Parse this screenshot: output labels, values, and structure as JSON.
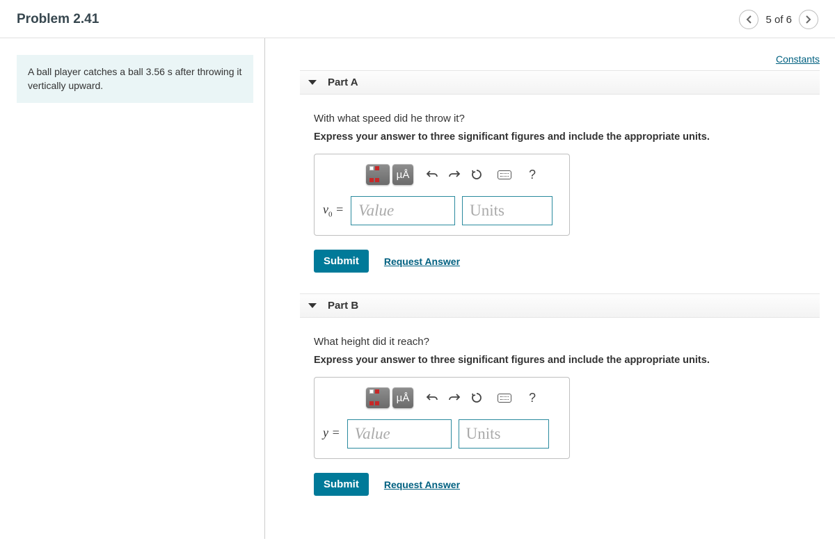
{
  "header": {
    "title": "Problem 2.41",
    "nav_count": "5 of 6"
  },
  "constants_link": "Constants",
  "prompt": "A ball player catches a ball 3.56 s after throwing it vertically upward.",
  "parts": {
    "a": {
      "title": "Part A",
      "question": "With what speed did he throw it?",
      "instruction": "Express your answer to three significant figures and include the appropriate units.",
      "variable_html": "v",
      "variable_sub": "0",
      "value_ph": "Value",
      "units_ph": "Units",
      "submit": "Submit",
      "request": "Request Answer"
    },
    "b": {
      "title": "Part B",
      "question": "What height did it reach?",
      "instruction": "Express your answer to three significant figures and include the appropriate units.",
      "variable_html": "y",
      "variable_sub": "",
      "value_ph": "Value",
      "units_ph": "Units",
      "submit": "Submit",
      "request": "Request Answer"
    }
  },
  "toolbar": {
    "units_label": "µÅ",
    "help": "?"
  }
}
